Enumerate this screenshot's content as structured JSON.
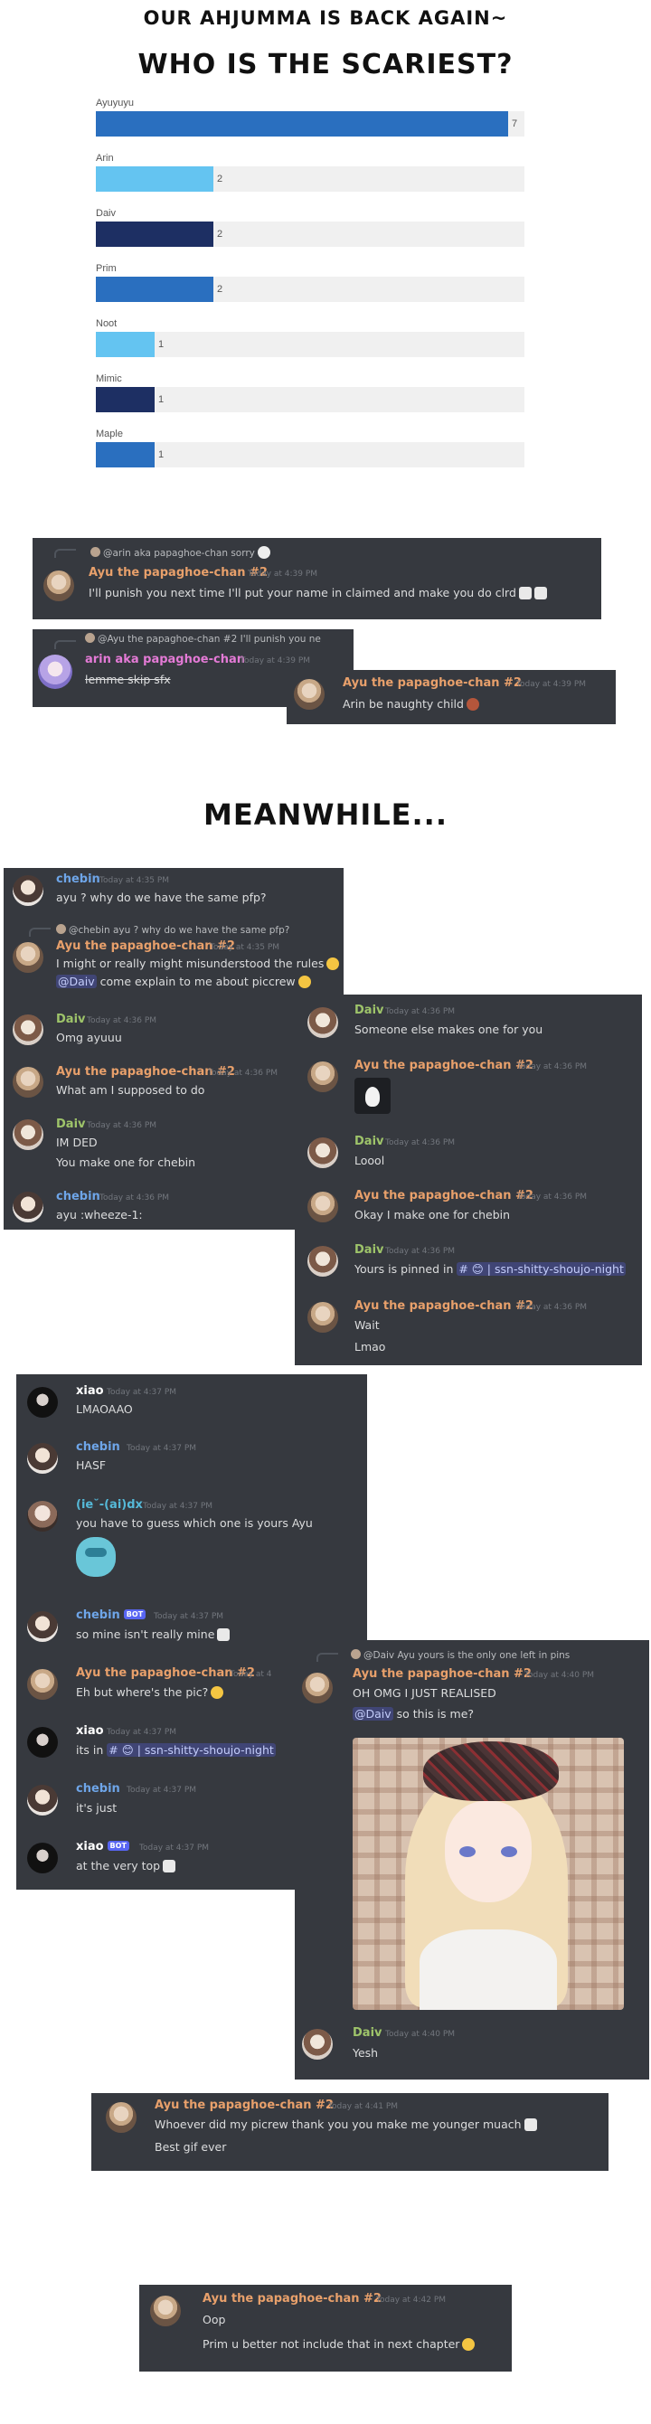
{
  "headings": {
    "top": "OUR AHJUMMA IS BACK AGAIN~",
    "question": "WHO IS THE SCARIEST?",
    "meanwhile": "MEANWHILE..."
  },
  "poll": {
    "max": 7,
    "options": [
      {
        "label": "Ayuyuyu",
        "count": "7",
        "value": 7,
        "color": "#2a6fbf"
      },
      {
        "label": "Arin",
        "count": "2",
        "value": 2,
        "color": "#64c4f1"
      },
      {
        "label": "Daiv",
        "count": "2",
        "value": 2,
        "color": "#1d2f63"
      },
      {
        "label": "Prim",
        "count": "2",
        "value": 2,
        "color": "#2a6fbf"
      },
      {
        "label": "Noot",
        "count": "1",
        "value": 1,
        "color": "#64c4f1"
      },
      {
        "label": "Mimic",
        "count": "1",
        "value": 1,
        "color": "#1d2f63"
      },
      {
        "label": "Maple",
        "count": "1",
        "value": 1,
        "color": "#2a6fbf"
      }
    ]
  },
  "chat1": {
    "reply_name": "@arin aka papaghoe-chan",
    "reply_text": "sorry",
    "name": "Ayu the papaghoe-chan #2",
    "time": "Today at 4:39 PM",
    "text": "I'll punish you next time I'll put your name in claimed and make you do clrd"
  },
  "chat2": {
    "reply_name": "@Ayu the papaghoe-chan #2",
    "reply_text": "I'll punish you ne",
    "name": "arin aka papaghoe-chan",
    "time": "Today at 4:39 PM",
    "text": "lemme skip sfx"
  },
  "chat3": {
    "name": "Ayu the papaghoe-chan #2",
    "time": "Today at 4:39 PM",
    "text": "Arin be naughty child"
  },
  "panelA": [
    {
      "name": "chebin",
      "time": "Today at 4:35 PM",
      "text": "ayu ? why do we have the same pfp?"
    },
    {
      "reply_name": "@chebin",
      "reply_text": "ayu ? why do we have the same pfp?",
      "name": "Ayu the papaghoe-chan #2",
      "time": "Today at 4:35 PM",
      "text": "I might or really might misunderstood the rules",
      "text2_mention": "@Daiv",
      "text2": "come explain to me about piccrew"
    },
    {
      "name": "Daiv",
      "time": "Today at 4:36 PM",
      "text": "Omg ayuuu"
    },
    {
      "name": "Ayu the papaghoe-chan #2",
      "time": "Today at 4:36 PM",
      "text": "What am I supposed to do"
    },
    {
      "name": "Daiv",
      "time": "Today at 4:36 PM",
      "text": "IM DED",
      "text2": "You make one for chebin"
    },
    {
      "name": "chebin",
      "time": "Today at 4:36 PM",
      "text": "ayu :wheeze-1:"
    }
  ],
  "panelB": [
    {
      "name": "Daiv",
      "time": "Today at 4:36 PM",
      "text": "Someone else makes one for you"
    },
    {
      "name": "Ayu the papaghoe-chan #2",
      "time": "Today at 4:36 PM"
    },
    {
      "name": "Daiv",
      "time": "Today at 4:36 PM",
      "text": "Loool"
    },
    {
      "name": "Ayu the papaghoe-chan #2",
      "time": "Today at 4:36 PM",
      "text": "Okay I make one for chebin"
    },
    {
      "name": "Daiv",
      "time": "Today at 4:36 PM",
      "text": "Yours is pinned in",
      "chan": "# 😊 | ssn-shitty-shoujo-night"
    },
    {
      "name": "Ayu the papaghoe-chan #2",
      "time": "Today at 4:36 PM",
      "text": "Wait",
      "text2": "Lmao"
    }
  ],
  "panelC": [
    {
      "name": "xiao",
      "time": "Today at 4:37 PM",
      "text": "LMAOAAO"
    },
    {
      "name": "chebin",
      "time": "Today at 4:37 PM",
      "text": "HASF"
    },
    {
      "name": "(ie˘-(ai)dx",
      "time": "Today at 4:37 PM",
      "text": "you have to guess which one is yours Ayu"
    },
    {
      "name": "chebin",
      "bot": "BOT",
      "time": "Today at 4:37 PM",
      "text": "so mine isn't really mine"
    },
    {
      "name": "Ayu the papaghoe-chan #2",
      "time": "Today at 4",
      "text": "Eh but where's the pic?"
    },
    {
      "name": "xiao",
      "time": "Today at 4:37 PM",
      "text": "its in",
      "chan": "# 😊 | ssn-shitty-shoujo-night"
    },
    {
      "name": "chebin",
      "time": "Today at 4:37 PM",
      "text": "it's just"
    },
    {
      "name": "xiao",
      "bot": "BOT",
      "time": "Today at 4:37 PM",
      "text": "at the very top"
    }
  ],
  "panelD": {
    "reply_name": "@Daiv",
    "reply_text": "Ayu yours is the only one left in pins",
    "name": "Ayu the papaghoe-chan #2",
    "time": "Today at 4:40 PM",
    "text": "OH OMG I JUST REALISED",
    "mention": "@Daiv",
    "text2": "so this is me?",
    "name2": "Daiv",
    "time2": "Today at 4:40 PM",
    "text3": "Yesh"
  },
  "panelE": {
    "name": "Ayu the papaghoe-chan #2",
    "time": "Today at 4:41 PM",
    "text": "Whoever did my picrew thank you you make me younger muach",
    "text2": "Best gif ever"
  },
  "panelF": {
    "name": "Ayu the papaghoe-chan #2",
    "time": "Today at 4:42 PM",
    "text": "Oop",
    "text2": "Prim u better not include that in next chapter"
  }
}
